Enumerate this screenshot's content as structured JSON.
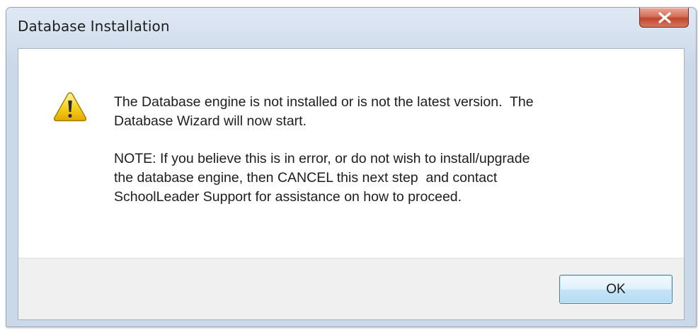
{
  "window": {
    "title": "Database Installation",
    "close_icon": "close-x-icon"
  },
  "dialog": {
    "icon": "warning-icon",
    "message_1": "The Database engine is not installed or is not the latest version.  The\nDatabase Wizard will now start.",
    "message_2": "NOTE: If you believe this is in error, or do not wish to install/upgrade\nthe database engine, then CANCEL this next step  and contact\nSchoolLeader Support for assistance on how to proceed."
  },
  "buttons": {
    "ok_label": "OK"
  },
  "colors": {
    "close_button": "#c94a30",
    "ok_button_border": "#3c7fb1",
    "warning_yellow": "#f2c400"
  }
}
